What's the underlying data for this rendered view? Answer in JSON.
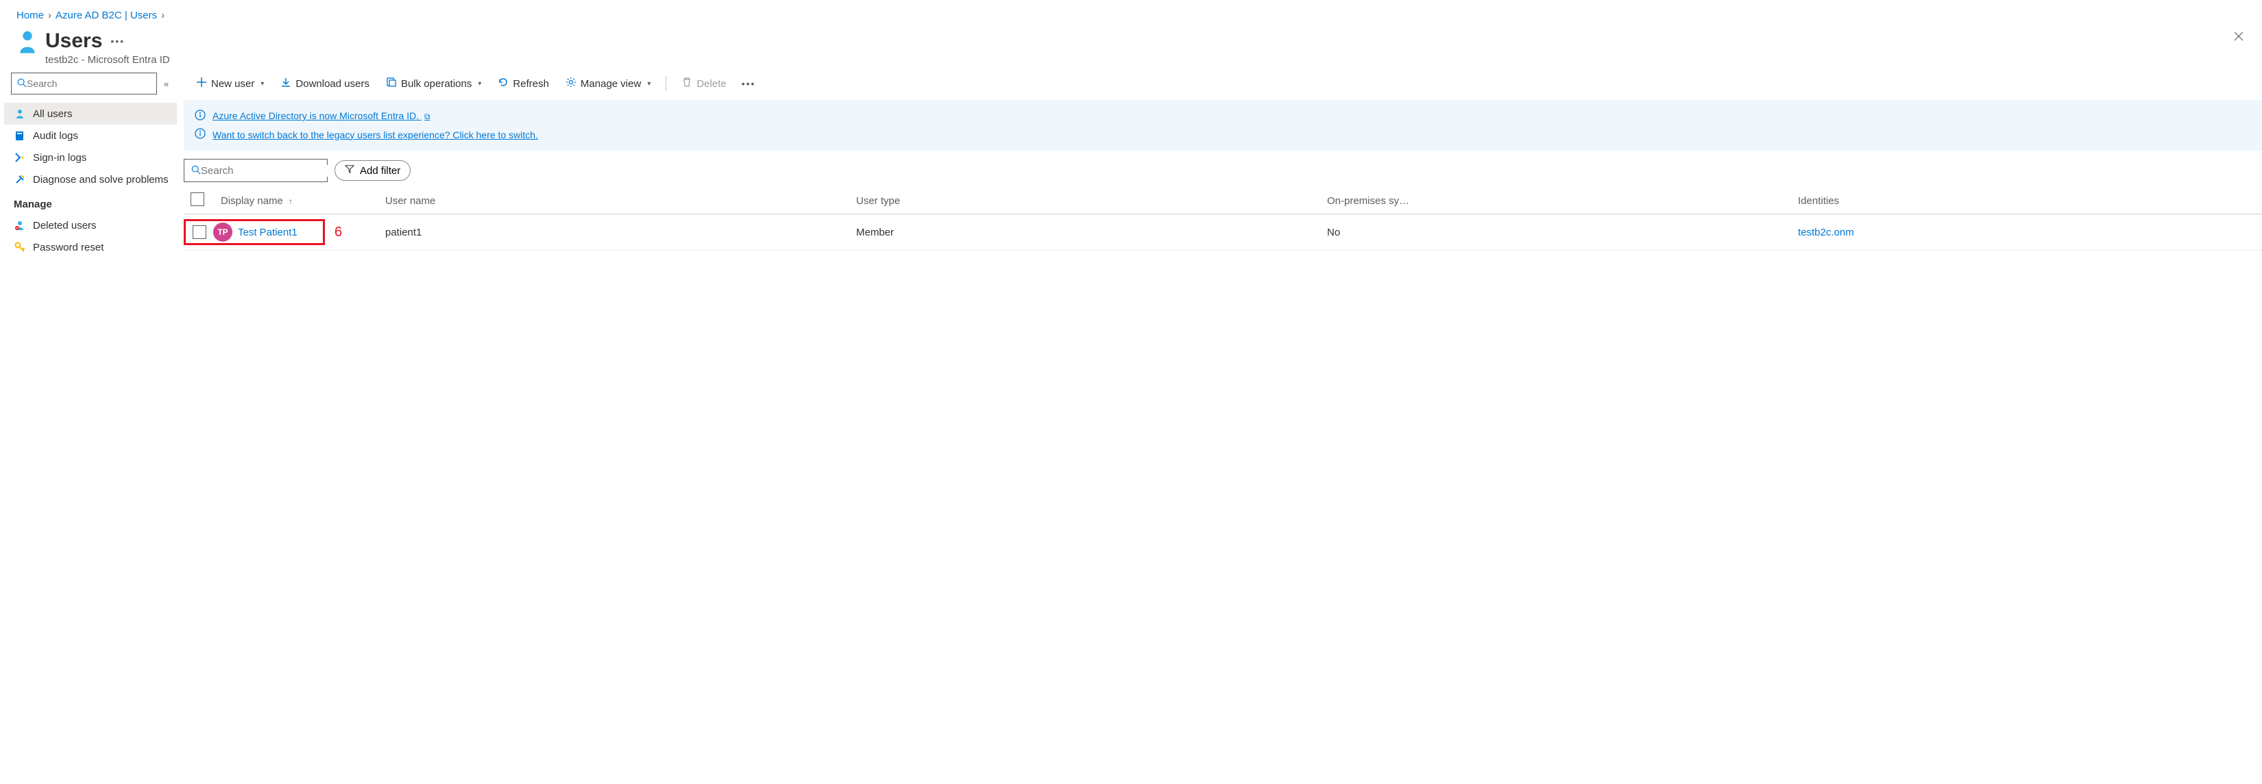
{
  "breadcrumb": {
    "home": "Home",
    "b2c": "Azure AD B2C | Users"
  },
  "header": {
    "title": "Users",
    "subtitle": "testb2c - Microsoft Entra ID"
  },
  "sidebar": {
    "search_placeholder": "Search",
    "items": [
      {
        "label": "All users"
      },
      {
        "label": "Audit logs"
      },
      {
        "label": "Sign-in logs"
      },
      {
        "label": "Diagnose and solve problems"
      }
    ],
    "section_manage": "Manage",
    "manage_items": [
      {
        "label": "Deleted users"
      },
      {
        "label": "Password reset"
      }
    ]
  },
  "toolbar": {
    "new_user": "New user",
    "download": "Download users",
    "bulk": "Bulk operations",
    "refresh": "Refresh",
    "manage_view": "Manage view",
    "delete": "Delete"
  },
  "banners": {
    "rename": "Azure Active Directory is now Microsoft Entra ID.",
    "switch": "Want to switch back to the legacy users list experience? Click here to switch."
  },
  "filter": {
    "search_placeholder": "Search",
    "add_filter": "Add filter"
  },
  "table": {
    "headers": {
      "display_name": "Display name",
      "user_name": "User name",
      "user_type": "User type",
      "on_prem": "On-premises sy…",
      "identities": "Identities"
    },
    "rows": [
      {
        "initials": "TP",
        "display_name": "Test Patient1",
        "user_name": "patient1",
        "user_type": "Member",
        "on_prem": "No",
        "identities": "testb2c.onm"
      }
    ]
  },
  "annotation": {
    "num": "6"
  }
}
